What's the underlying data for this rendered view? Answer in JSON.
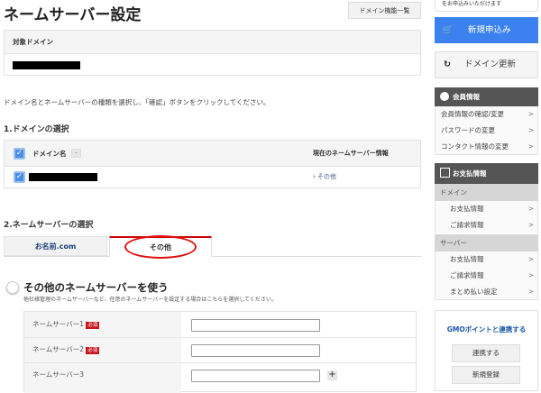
{
  "header": {
    "title": "ネームサーバー設定",
    "domain_list_button": "ドメイン機能一覧"
  },
  "target_domain": {
    "label": "対象ドメイン"
  },
  "instruction": "ドメイン名とネームサーバーの種類を選択し、「確認」ボタンをクリックしてください。",
  "section1": {
    "title": "1.ドメインの選択",
    "col_domain": "ドメイン名",
    "sort_label": "-",
    "col_ns": "現在のネームサーバー情報",
    "rows": [
      {
        "ns": "その他"
      }
    ]
  },
  "section2": {
    "title": "2.ネームサーバーの選択",
    "tabs": [
      {
        "label": "お名前.com"
      },
      {
        "label": "その他"
      }
    ],
    "option_title": "その他のネームサーバーを使う",
    "option_desc": "他社様管理のネームサーバーなど、任意のネームサーバーを設定する場合はこちらを選択してください。",
    "fields": [
      {
        "label": "ネームサーバー1",
        "required": "必須",
        "value": ""
      },
      {
        "label": "ネームサーバー2",
        "required": "必須",
        "value": ""
      },
      {
        "label": "ネームサーバー3",
        "value": ""
      }
    ],
    "add_label": "+"
  },
  "sidebar": {
    "bubble": "をお申込みいただけます",
    "new_order": "新規申込み",
    "renew": "ドメイン更新",
    "member": {
      "title": "会員情報",
      "items": [
        "会員情報の確認/変更",
        "パスワードの変更",
        "コンタクト情報の変更"
      ]
    },
    "payment": {
      "title": "お支払情報",
      "domain_label": "ドメイン",
      "domain_items": [
        "お支払情報",
        "ご請求情報"
      ],
      "server_label": "サーバー",
      "server_items": [
        "お支払情報",
        "ご請求情報",
        "まとめ払い設定"
      ]
    },
    "gmo": {
      "title": "GMOポイントと連携する",
      "link": "連携する",
      "register": "新規登録"
    }
  },
  "colors": {
    "accent": "#3b82f0",
    "required": "#c8161d",
    "tab_active": "#cc0000"
  }
}
